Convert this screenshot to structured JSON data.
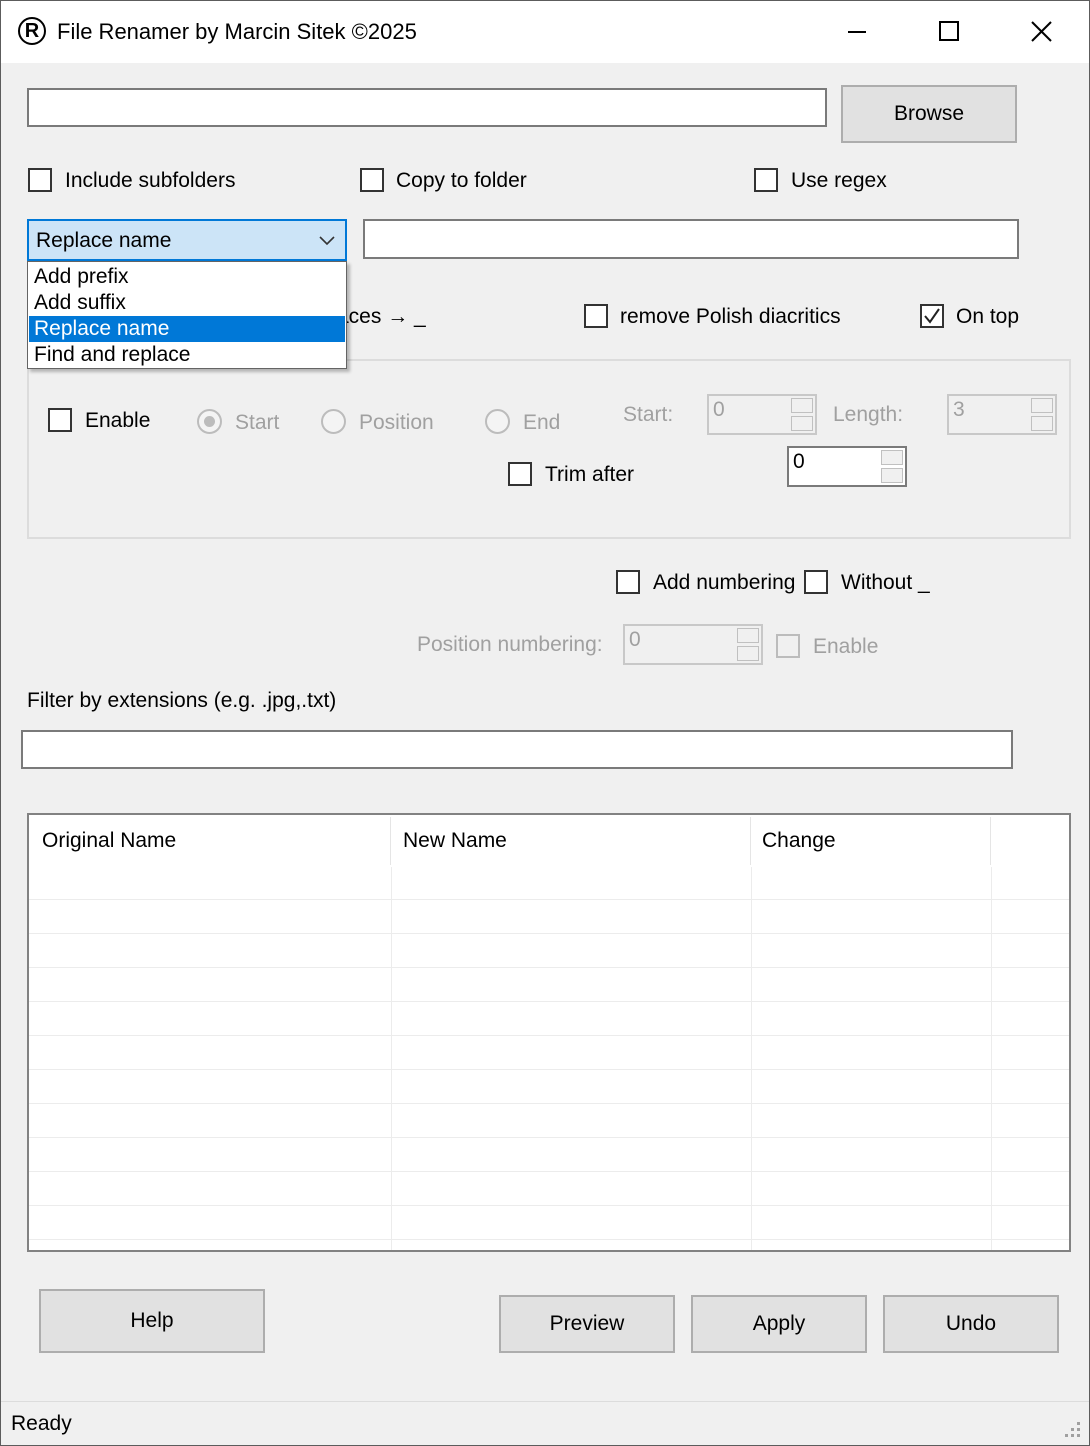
{
  "window": {
    "logo_glyph": "R",
    "title": "File Renamer by Marcin Sitek ©2025"
  },
  "folder": {
    "path_value": "",
    "browse_label": "Browse"
  },
  "options": {
    "include_subfolders": "Include subfolders",
    "copy_to_folder": "Copy to folder",
    "use_regex": "Use regex"
  },
  "mode_combo": {
    "selected": "Replace name",
    "text_value": "",
    "items": [
      "Add prefix",
      "Add suffix",
      "Replace name",
      "Find and replace"
    ],
    "highlighted_index": 2
  },
  "row2": {
    "spaces_label": "aces → _",
    "remove_polish": "remove Polish diacritics",
    "on_top": "On top",
    "on_top_checked": true
  },
  "trim": {
    "enable": "Enable",
    "start": "Start",
    "position": "Position",
    "end": "End",
    "start_label": "Start:",
    "start_value": "0",
    "length_label": "Length:",
    "length_value": "3",
    "trim_after": "Trim after",
    "trim_after_value": "0"
  },
  "numbering": {
    "add_numbering": "Add numbering",
    "without": "Without _",
    "position_label": "Position numbering:",
    "position_value": "0",
    "enable": "Enable"
  },
  "filter": {
    "label": "Filter by extensions (e.g. .jpg,.txt)",
    "value": ""
  },
  "table": {
    "columns": [
      "Original Name",
      "New Name",
      "Change"
    ],
    "rows": []
  },
  "buttons": {
    "help": "Help",
    "preview": "Preview",
    "apply": "Apply",
    "undo": "Undo"
  },
  "status": {
    "text": "Ready"
  },
  "colors": {
    "accent": "#0078d7",
    "combo_bg": "#cce4f7",
    "window_bg": "#f0f0f0"
  }
}
